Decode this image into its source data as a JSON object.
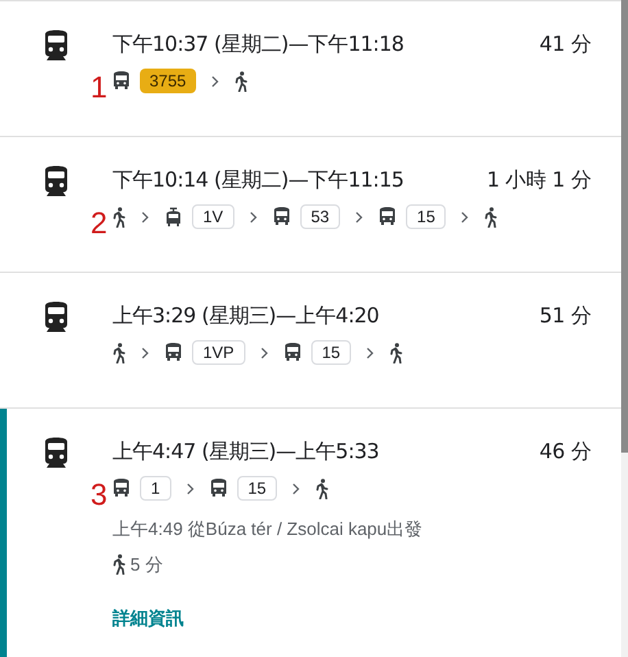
{
  "routes": [
    {
      "selected": false,
      "depart": "下午10:37 (星期二)—下午11:18",
      "duration": "41 分",
      "annotation": "1",
      "steps": [
        {
          "kind": "bus",
          "line": "3755",
          "color": "#e8ad14"
        },
        {
          "kind": "walk"
        }
      ]
    },
    {
      "selected": false,
      "depart": "下午10:14 (星期二)—下午11:15",
      "duration": "1 小時 1 分",
      "annotation": "2",
      "steps": [
        {
          "kind": "walk"
        },
        {
          "kind": "tram",
          "line": "1V"
        },
        {
          "kind": "bus",
          "line": "53"
        },
        {
          "kind": "bus",
          "line": "15"
        },
        {
          "kind": "walk"
        }
      ]
    },
    {
      "selected": false,
      "depart": "上午3:29 (星期三)—上午4:20",
      "duration": "51 分",
      "steps": [
        {
          "kind": "walk"
        },
        {
          "kind": "bus",
          "line": "1VP"
        },
        {
          "kind": "bus",
          "line": "15"
        },
        {
          "kind": "walk"
        }
      ]
    },
    {
      "selected": true,
      "depart": "上午4:47 (星期三)—上午5:33",
      "duration": "46 分",
      "annotation": "3",
      "steps": [
        {
          "kind": "bus",
          "line": "1"
        },
        {
          "kind": "bus",
          "line": "15"
        },
        {
          "kind": "walk"
        }
      ],
      "detail": "上午4:49 從Búza tér / Zsolcai kapu出發",
      "walk_time": "5 分",
      "link": "詳細資訊"
    }
  ]
}
